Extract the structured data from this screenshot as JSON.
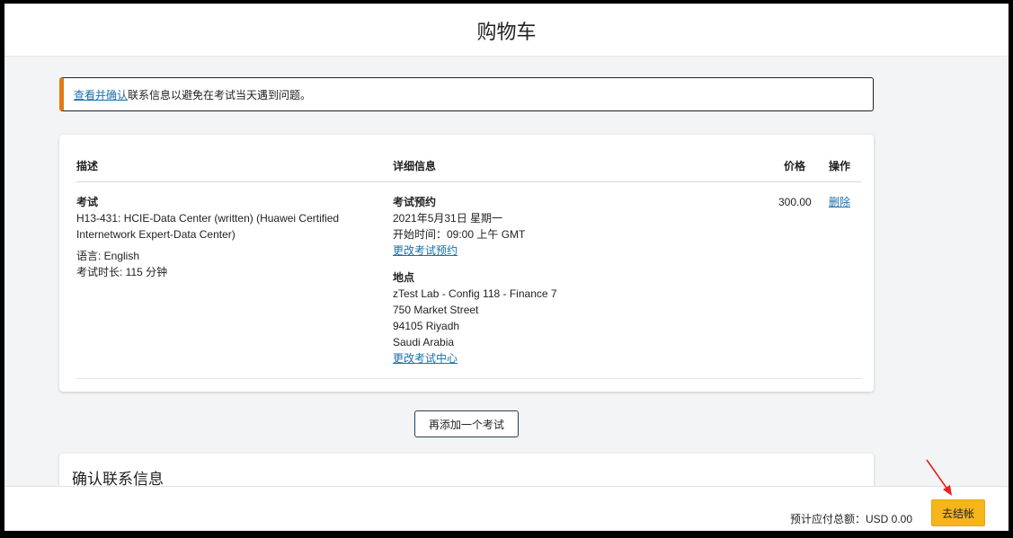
{
  "header": {
    "title": "购物车"
  },
  "alert": {
    "link_text": "查看并确认",
    "message": "联系信息以避免在考试当天遇到问题。"
  },
  "table": {
    "headers": {
      "description": "描述",
      "details": "详细信息",
      "price": "价格",
      "action": "操作"
    },
    "row": {
      "type": "考试",
      "exam_name": "H13-431: HCIE-Data Center (written) (Huawei Certified Internetwork Expert-Data Center)",
      "language": "语言: English",
      "duration": "考试时长: 115 分钟",
      "appointment_heading": "考试预约",
      "date": "2021年5月31日 星期一",
      "start_time": "开始时间：09:00 上午 GMT",
      "change_appointment": "更改考试预约",
      "location_heading": "地点",
      "location_lines": [
        "zTest Lab - Config 118 - Finance 7",
        "750 Market Street",
        "94105 Riyadh",
        "Saudi Arabia"
      ],
      "change_center": "更改考试中心",
      "price": "300.00",
      "delete": "删除"
    }
  },
  "add_exam_button": "再添加一个考试",
  "contact_section": {
    "title": "确认联系信息"
  },
  "footer": {
    "total_label": "预计应付总额：",
    "total_value": "USD 0.00",
    "checkout_button": "去结帐"
  },
  "colors": {
    "accent_orange": "#e07b17",
    "link_blue": "#1b6fa8",
    "checkout_yellow": "#f5b51b",
    "annotation_red": "#e8211d"
  }
}
